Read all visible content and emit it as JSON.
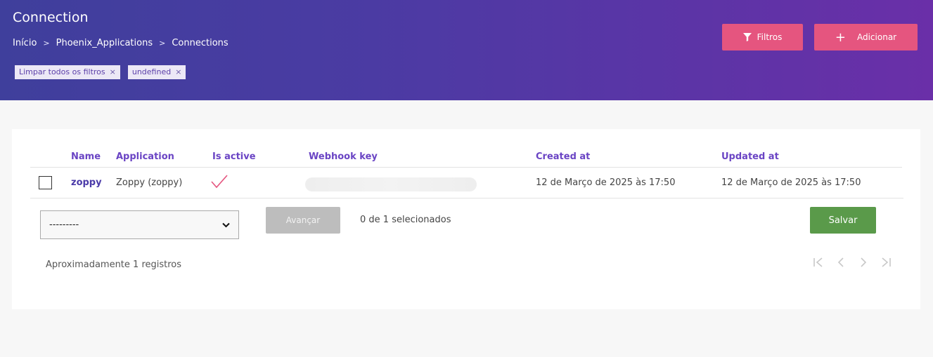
{
  "header": {
    "title": "Connection",
    "breadcrumb": [
      "Início",
      "Phoenix_Applications",
      "Connections"
    ],
    "chips": [
      {
        "label": "Limpar todos os filtros",
        "close": "×"
      },
      {
        "label": "undefined",
        "close": "×"
      }
    ],
    "filter_button": "Filtros",
    "add_button": "Adicionar",
    "add_icon": "+"
  },
  "table": {
    "columns": [
      "Name",
      "Application",
      "Is active",
      "Webhook key",
      "Created at",
      "Updated at"
    ],
    "rows": [
      {
        "name": "zoppy",
        "application": "Zoppy (zoppy)",
        "is_active_icon": "check-icon",
        "created_at": "12 de Março de 2025 às 17:50",
        "updated_at": "12 de Março de 2025 às 17:50"
      }
    ]
  },
  "actions": {
    "select_value": "---------",
    "advance_button": "Avançar",
    "selected_count": "0 de 1 selecionados",
    "save_button": "Salvar"
  },
  "footer": {
    "records_text": "Aproximadamente 1 registros"
  },
  "colors": {
    "header_start": "#3f3f9c",
    "header_end": "#6a2fa8",
    "pink_button": "#e5557f",
    "save_green": "#5a9a4a",
    "column_header": "#6a44c4",
    "check": "#e5557f"
  }
}
